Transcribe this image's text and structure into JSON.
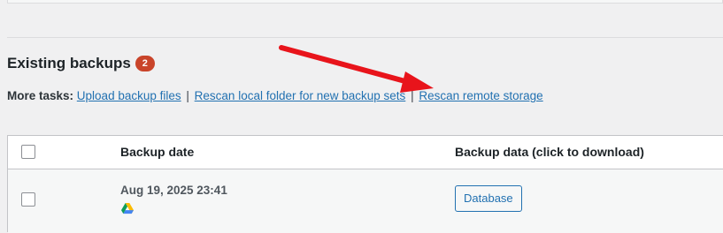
{
  "section": {
    "title": "Existing backups",
    "count": "2"
  },
  "more_tasks": {
    "label": "More tasks:",
    "links": [
      "Upload backup files",
      "Rescan local folder for new backup sets",
      "Rescan remote storage"
    ],
    "separator": "|"
  },
  "table": {
    "columns": {
      "date": "Backup date",
      "data": "Backup data (click to download)"
    },
    "rows": [
      {
        "date": "Aug 19, 2025 23:41",
        "storage_icon": "google-drive-icon",
        "data_button": "Database"
      }
    ]
  },
  "annotation": {
    "arrow_color": "#e8141b"
  }
}
